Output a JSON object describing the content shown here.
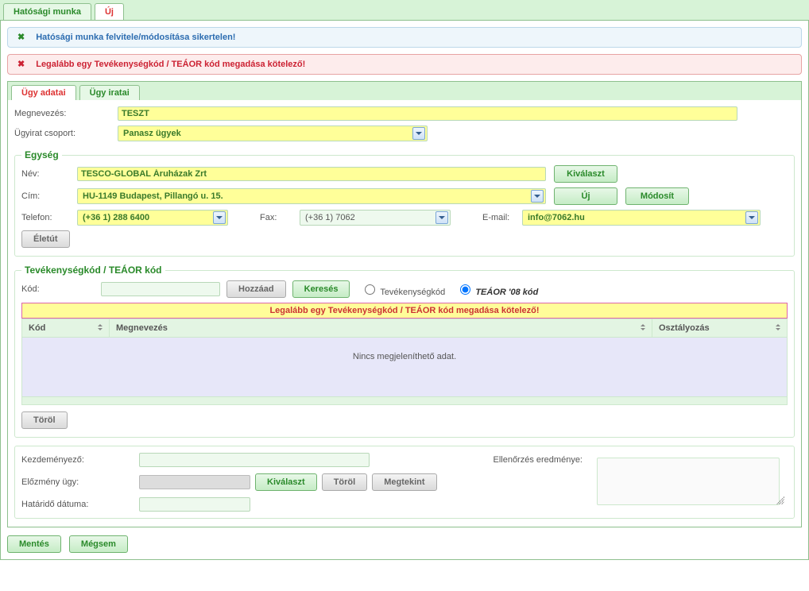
{
  "top_tabs": {
    "main": "Hatósági munka",
    "new": "Új"
  },
  "alerts": {
    "info": "Hatósági munka felvitele/módosítása sikertelen!",
    "error": "Legalább egy Tevékenységkód / TEÁOR kód megadása kötelező!"
  },
  "inner_tabs": {
    "data": "Ügy adatai",
    "docs": "Ügy iratai"
  },
  "labels": {
    "megnevezes": "Megnevezés:",
    "ugyirat_csoport": "Ügyirat csoport:",
    "egyseg": "Egység",
    "nev": "Név:",
    "cim": "Cím:",
    "telefon": "Telefon:",
    "fax": "Fax:",
    "email": "E-mail:",
    "tevekenyseg_header": "Tevékenységkód / TEÁOR kód",
    "kod": "Kód:",
    "kezdemenyezo": "Kezdeményező:",
    "elozmeny": "Előzmény ügy:",
    "hatarido": "Határidő dátuma:",
    "ellenorzes": "Ellenőrzés eredménye:"
  },
  "buttons": {
    "kivalaszt": "Kiválaszt",
    "uj": "Új",
    "modosit": "Módosít",
    "eletut": "Életút",
    "hozzaad": "Hozzáad",
    "kereses": "Keresés",
    "torol": "Töröl",
    "megtekint": "Megtekint",
    "mentes": "Mentés",
    "megsem": "Mégsem"
  },
  "values": {
    "megnevezes": "TESZT",
    "ugyirat_csoport": "Panasz ügyek",
    "nev": "TESCO-GLOBAL Áruházak Zrt",
    "cim": "HU-1149 Budapest, Pillangó u. 15.",
    "telefon": "(+36 1) 288 6400",
    "fax": "(+36 1) 7062",
    "email": "info@7062.hu",
    "kod": ""
  },
  "radios": {
    "tevekenyseg": "Tevékenységkód",
    "teaor": "TEÁOR '08 kód"
  },
  "grid": {
    "warn": "Legalább egy Tevékenységkód / TEÁOR kód megadása kötelező!",
    "col_kod": "Kód",
    "col_megnevezes": "Megnevezés",
    "col_osztalyozas": "Osztályozás",
    "empty": "Nincs megjeleníthető adat."
  }
}
